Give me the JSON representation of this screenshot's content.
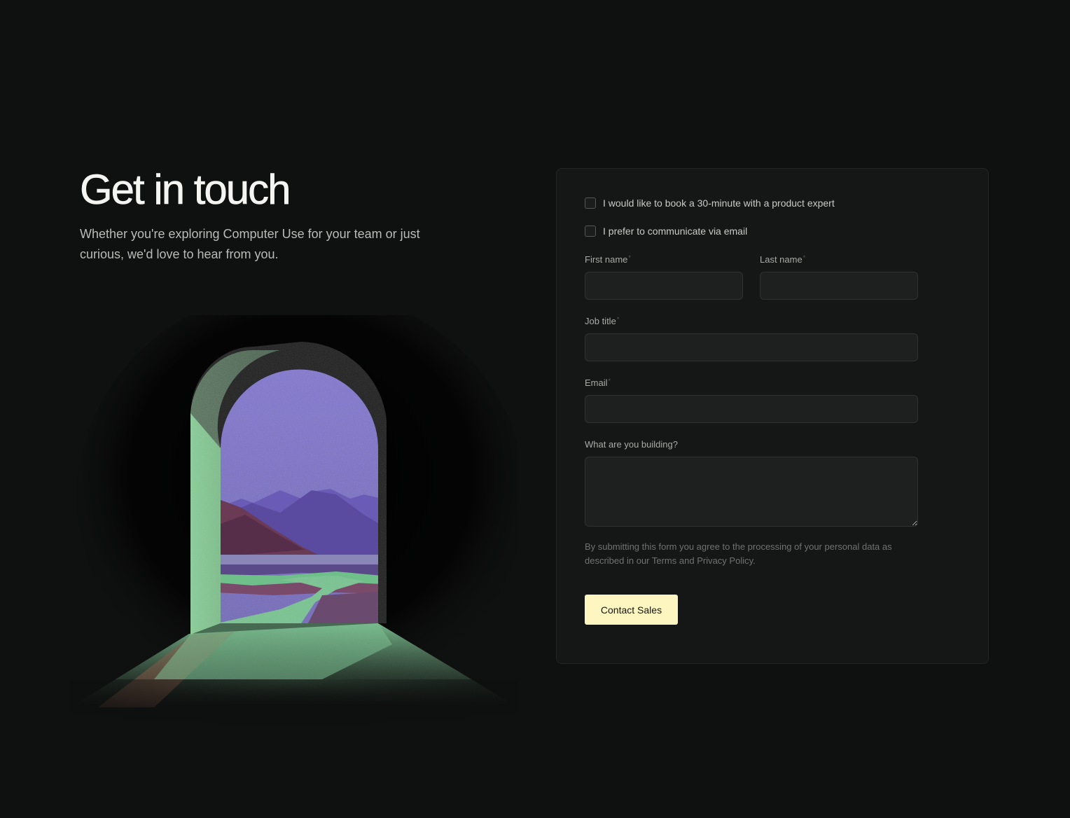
{
  "hero": {
    "title": "Get in touch",
    "subtitle": "Whether you're exploring Computer Use for your team or just curious, we'd love to hear from you."
  },
  "illustration": {
    "icon": "arched-doorway-landscape-illustration",
    "colors": {
      "sky": "#7a6ec8",
      "mountains": "#5b4b9f",
      "path": "#6fbf8a",
      "arch_wall": "#7fc48c"
    }
  },
  "form": {
    "options": [
      {
        "label": "I would like to book a 30-minute with a product expert",
        "checked": false
      },
      {
        "label": "I prefer to communicate via email",
        "checked": false
      }
    ],
    "fields": {
      "first_name": {
        "label": "First name",
        "required_mark": "*",
        "value": "",
        "placeholder": ""
      },
      "last_name": {
        "label": "Last name",
        "required_mark": "*",
        "value": "",
        "placeholder": ""
      },
      "job_title": {
        "label": "Job title",
        "required_mark": "*",
        "value": "",
        "placeholder": ""
      },
      "email": {
        "label": "Email",
        "required_mark": "*",
        "value": "",
        "placeholder": ""
      },
      "building": {
        "label": "What are you building?",
        "value": "",
        "placeholder": ""
      }
    },
    "legal": {
      "before": "By submitting this form you agree to the processing of your personal data as described in our ",
      "terms": "Terms",
      "and": " and ",
      "privacy": "Privacy Policy",
      "after": "."
    },
    "submit_label": "Contact Sales"
  },
  "theme": {
    "background": "#0f1110",
    "card": "#151716",
    "button": "#fdf6c1"
  }
}
